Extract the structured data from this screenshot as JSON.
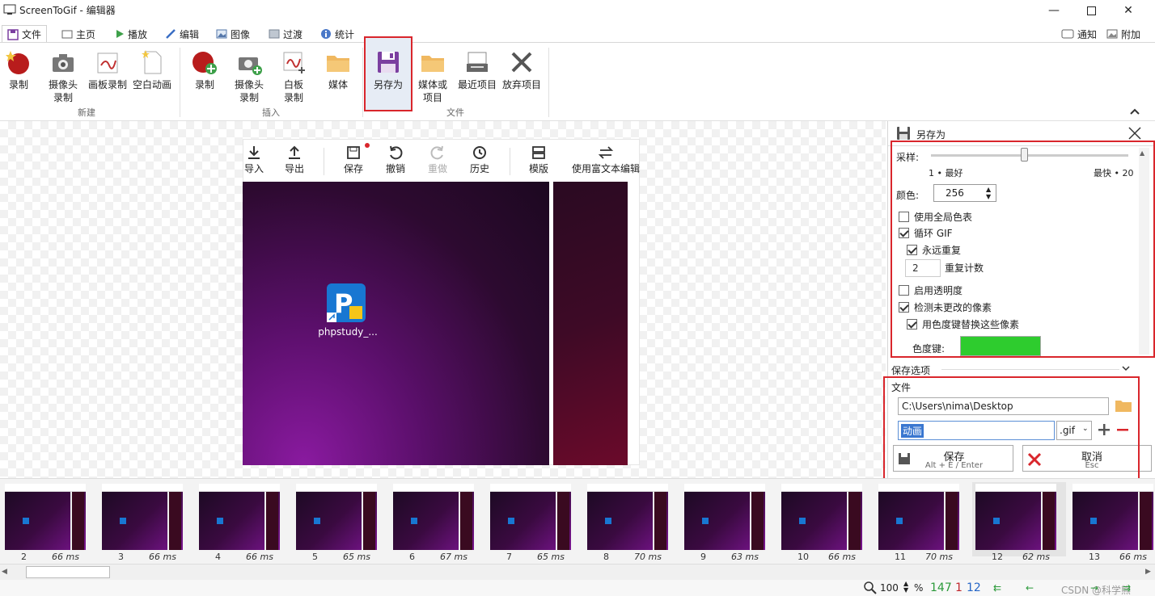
{
  "window": {
    "title": "ScreenToGif - 编辑器"
  },
  "tabs": [
    {
      "label": "文件",
      "icon": "floppy-icon"
    },
    {
      "label": "主页",
      "icon": "home-icon"
    },
    {
      "label": "播放",
      "icon": "play-icon"
    },
    {
      "label": "编辑",
      "icon": "pencil-icon"
    },
    {
      "label": "图像",
      "icon": "image-icon"
    },
    {
      "label": "过渡",
      "icon": "transition-icon"
    },
    {
      "label": "统计",
      "icon": "info-icon"
    }
  ],
  "top_right": {
    "notify": "通知",
    "attach": "附加"
  },
  "ribbon": {
    "new_group": "新建",
    "insert_group": "插入",
    "file_group": "文件",
    "buttons": {
      "record": "录制",
      "webcam": "摄像头\n录制",
      "board": "画板录制",
      "blank": "空白动画",
      "ins_record": "录制",
      "ins_webcam": "摄像头\n录制",
      "ins_board": "白板\n录制",
      "ins_media": "媒体",
      "save_as": "另存为",
      "media_or_project": "媒体或\n项目",
      "recent": "最近项目",
      "discard": "放弃项目"
    }
  },
  "frame_toolbar": {
    "import": "导入",
    "export": "导出",
    "save": "保存",
    "undo": "撤销",
    "redo": "重做",
    "history": "历史",
    "template": "模版",
    "rich_text": "使用富文本编辑"
  },
  "desktop_icon": {
    "label": "phpstudy_..."
  },
  "save_panel": {
    "title": "另存为",
    "sampling_label": "采样:",
    "sampling_min": "1 • 最好",
    "sampling_max": "最快 • 20",
    "colors_label": "颜色:",
    "colors_value": "256",
    "use_global_palette": "使用全局色表",
    "loop_gif": "循环 GIF",
    "repeat_forever": "永远重复",
    "repeat_count_value": "2",
    "repeat_count_label": "重复计数",
    "enable_transparency": "启用透明度",
    "detect_unchanged": "检测未更改的像素",
    "replace_with_chroma": "用色度键替换这些像素",
    "chroma_label": "色度键:",
    "chroma_color": "#2ecc2e",
    "save_options": "保存选项",
    "file_section": "文件",
    "path": "C:\\Users\\nima\\Desktop",
    "filename": "动画",
    "extension": ".gif",
    "save_btn": "保存",
    "save_shortcut": "Alt + E / Enter",
    "cancel_btn": "取消",
    "cancel_shortcut": "Esc"
  },
  "frames": [
    {
      "num": "2",
      "ms": "66 ms"
    },
    {
      "num": "3",
      "ms": "66 ms"
    },
    {
      "num": "4",
      "ms": "66 ms"
    },
    {
      "num": "5",
      "ms": "65 ms"
    },
    {
      "num": "6",
      "ms": "67 ms"
    },
    {
      "num": "7",
      "ms": "65 ms"
    },
    {
      "num": "8",
      "ms": "70 ms"
    },
    {
      "num": "9",
      "ms": "63 ms"
    },
    {
      "num": "10",
      "ms": "66 ms"
    },
    {
      "num": "11",
      "ms": "70 ms"
    },
    {
      "num": "12",
      "ms": "62 ms"
    },
    {
      "num": "13",
      "ms": "66 ms"
    }
  ],
  "status": {
    "zoom": "100",
    "zoom_unit": "%",
    "total_frames": "147",
    "selected": "1",
    "current": "12",
    "watermark": "CSDN @科学熊"
  }
}
